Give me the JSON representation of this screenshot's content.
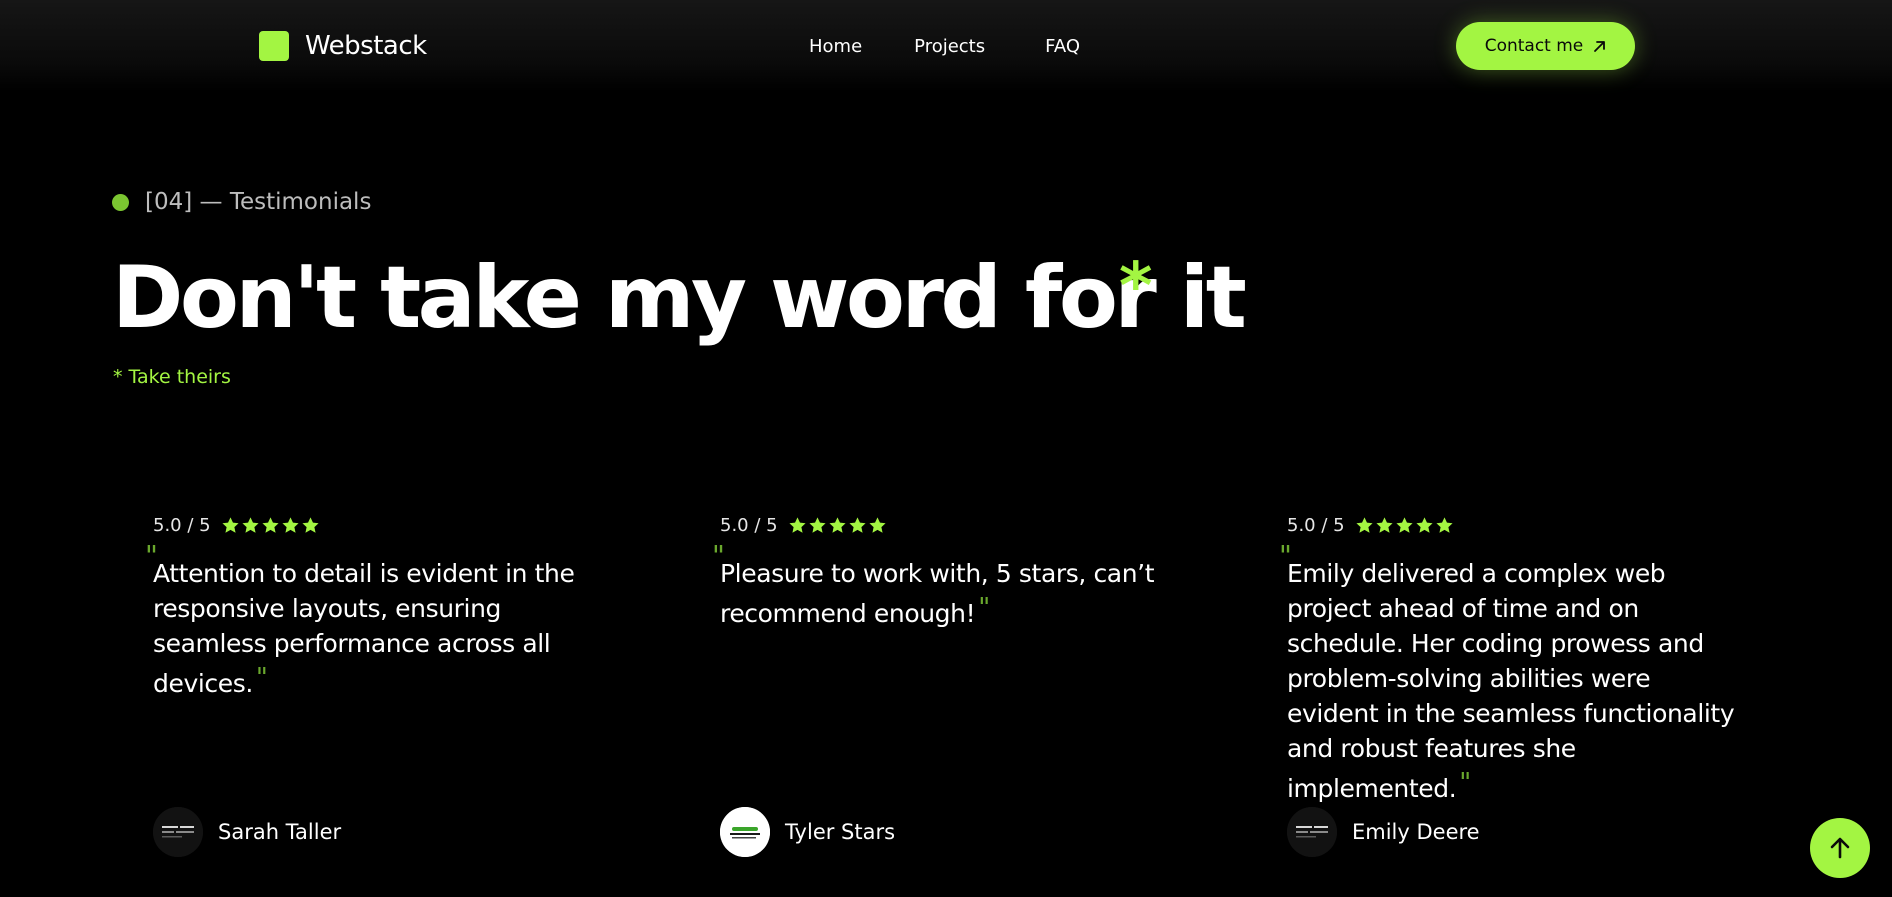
{
  "header": {
    "logo_text": "Webstack",
    "nav": [
      {
        "label": "Home"
      },
      {
        "label": "Projects"
      },
      {
        "label": "FAQ"
      }
    ],
    "contact_label": "Contact me"
  },
  "section": {
    "eyebrow": "[04] — Testimonials",
    "headline": "Don't take my word for it",
    "headline_star": "*",
    "subnote": "* Take theirs"
  },
  "testimonials": [
    {
      "rating": "5.0 / 5",
      "stars": 5,
      "quote": "Attention to detail is evident in the responsive layouts, ensuring seamless performance across all devices.",
      "author": "Sarah Taller",
      "avatar": "dark-logo-avatar"
    },
    {
      "rating": "5.0 / 5",
      "stars": 5,
      "quote": "Pleasure to work with, 5 stars, can’t recommend enough!",
      "author": "Tyler Stars",
      "avatar": "light-logo-avatar"
    },
    {
      "rating": "5.0 / 5",
      "stars": 5,
      "quote": "Emily delivered a complex web project ahead of time and on schedule. Her coding prowess and problem-solving abilities were evident in the seamless functionality and robust features she implemented.",
      "author": "Emily Deere",
      "avatar": "dark-logo-avatar"
    }
  ],
  "colors": {
    "accent": "#a3f542",
    "background": "#000000",
    "quote_mark": "#6aa82d"
  },
  "icons": {
    "contact": "arrow-up-right-icon",
    "scroll_top": "arrow-up-icon",
    "rating": "star-icon"
  }
}
